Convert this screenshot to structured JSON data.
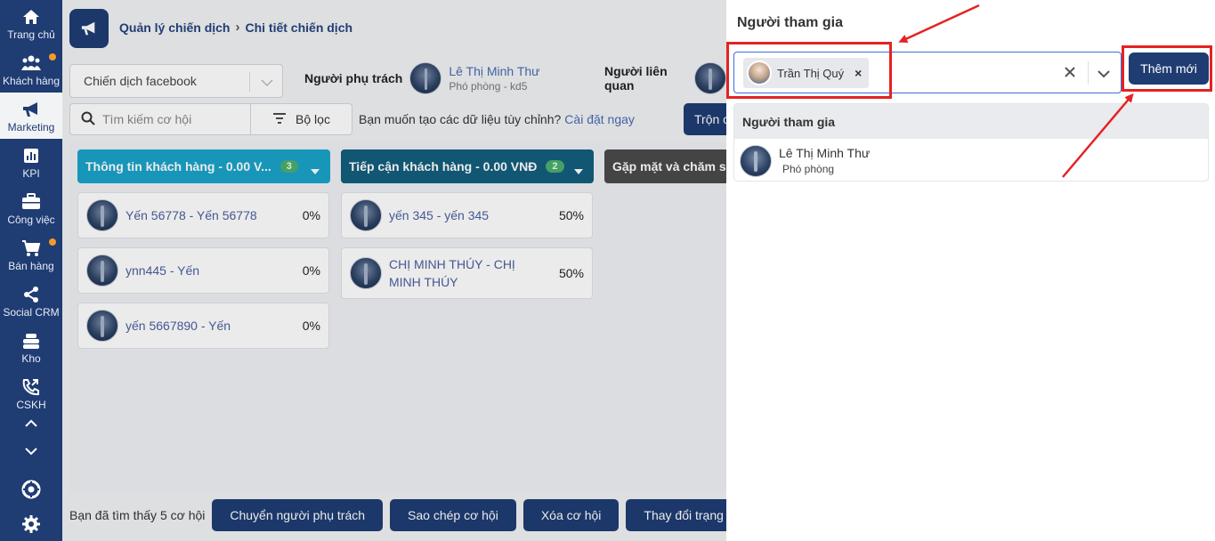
{
  "sidebar": {
    "items": [
      {
        "label": "Trang chủ",
        "icon": "home-icon"
      },
      {
        "label": "Khách hàng",
        "icon": "users-icon",
        "dot": true
      },
      {
        "label": "Marketing",
        "icon": "megaphone-icon",
        "active": true
      },
      {
        "label": "KPI",
        "icon": "chart-icon"
      },
      {
        "label": "Công việc",
        "icon": "briefcase-icon"
      },
      {
        "label": "Bán hàng",
        "icon": "cart-icon",
        "dot": true
      },
      {
        "label": "Social CRM",
        "icon": "share-icon"
      },
      {
        "label": "Kho",
        "icon": "warehouse-icon"
      },
      {
        "label": "CSKH",
        "icon": "phone-icon"
      }
    ]
  },
  "breadcrumb": {
    "parent": "Quản lý chiến dịch",
    "current": "Chi tiết chiến dịch"
  },
  "campaign_select": {
    "value": "Chiến dịch facebook"
  },
  "owner": {
    "role_label": "Người phụ trách",
    "name": "Lê Thị Minh Thư",
    "title": "Phó phòng - kd5"
  },
  "related": {
    "role_label": "Người liên quan"
  },
  "search": {
    "placeholder": "Tìm kiếm cơ hội"
  },
  "filter": {
    "label": "Bộ lọc"
  },
  "custom_data": {
    "question": "Bạn muốn tạo các dữ liệu tùy chỉnh?",
    "link": "Cài đặt ngay"
  },
  "merge_button": {
    "label": "Trộn c"
  },
  "columns": [
    {
      "title": "Thông tin khách hàng - 0.00 V...",
      "count": "3",
      "color": "#1aa3c9",
      "cards": [
        {
          "name": "Yến 56778 - Yến 56778",
          "pct": "0%"
        },
        {
          "name": "ynn445 - Yến",
          "pct": "0%"
        },
        {
          "name": "yến 5667890 - Yến",
          "pct": "0%"
        }
      ]
    },
    {
      "title": "Tiếp cận khách hàng - 0.00 VNĐ",
      "count": "2",
      "color": "#135e7d",
      "cards": [
        {
          "name": "yến 345 - yến 345",
          "pct": "50%"
        },
        {
          "name": "CHỊ MINH THÚY - CHỊ MINH THÚY",
          "pct": "50%"
        }
      ]
    },
    {
      "title": "Gặp mặt và chăm sóc",
      "color": "#4a4a4a",
      "cards": []
    }
  ],
  "bottom": {
    "found": "Bạn đã tìm thấy 5 cơ hội",
    "buttons": [
      "Chuyển người phụ trách",
      "Sao chép cơ hội",
      "Xóa cơ hội",
      "Thay đổi trạng th"
    ]
  },
  "panel": {
    "title": "Người tham gia",
    "selected_chip": "Trần Thị Quý",
    "add_button": "Thêm mới",
    "table_header": "Người tham gia",
    "rows": [
      {
        "name": "Lê Thị Minh Thư",
        "title": "Phó phòng"
      }
    ]
  },
  "colors": {
    "sidebar": "#1f3c73",
    "primary_button": "#1f3c73",
    "annotation": "#e52222"
  }
}
